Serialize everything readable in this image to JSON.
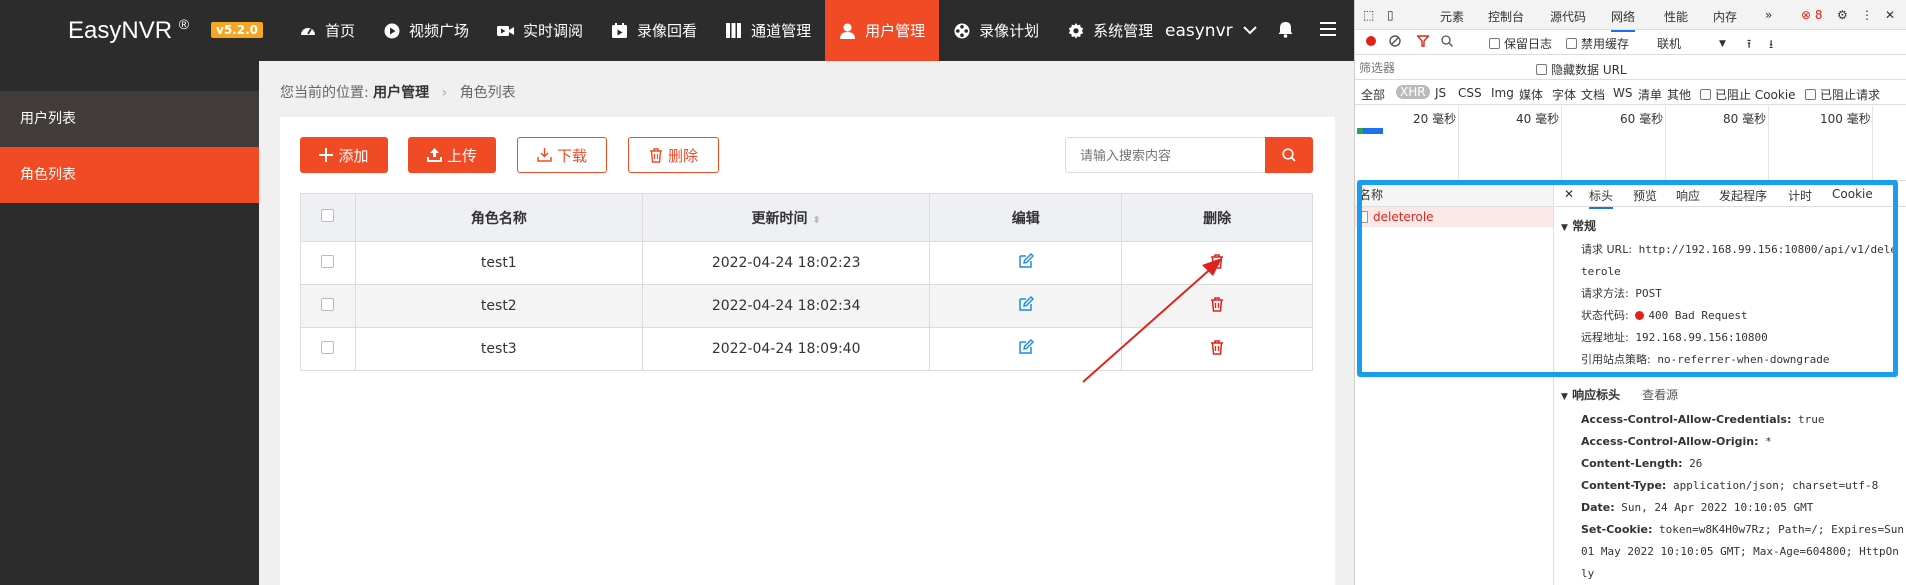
{
  "header": {
    "logo": "EasyNVR",
    "logo_mark": "®",
    "version": "v5.2.0",
    "nav": [
      {
        "label": "首页",
        "icon": "dashboard-icon"
      },
      {
        "label": "视频广场",
        "icon": "play-circle-icon"
      },
      {
        "label": "实时调阅",
        "icon": "video-camera-icon"
      },
      {
        "label": "录像回看",
        "icon": "calendar-video-icon"
      },
      {
        "label": "通道管理",
        "icon": "columns-icon"
      },
      {
        "label": "用户管理",
        "icon": "user-icon",
        "active": true
      },
      {
        "label": "录像计划",
        "icon": "film-reel-icon"
      },
      {
        "label": "系统管理",
        "icon": "gear-icon"
      }
    ],
    "username": "easynvr",
    "accent_color": "#f14b25"
  },
  "sidebar": {
    "items": [
      {
        "label": "用户列表"
      },
      {
        "label": "角色列表",
        "active": true
      }
    ]
  },
  "breadcrumb": {
    "prefix": "您当前的位置:",
    "parent": "用户管理",
    "current": "角色列表"
  },
  "toolbar": {
    "add_label": "添加",
    "upload_label": "上传",
    "download_label": "下载",
    "delete_label": "删除",
    "search_placeholder": "请输入搜索内容"
  },
  "table": {
    "headers": [
      "角色名称",
      "更新时间",
      "编辑",
      "删除"
    ],
    "rows": [
      {
        "name": "test1",
        "updated": "2022-04-24 18:02:23"
      },
      {
        "name": "test2",
        "updated": "2022-04-24 18:02:34"
      },
      {
        "name": "test3",
        "updated": "2022-04-24 18:09:40"
      }
    ]
  },
  "devtools": {
    "tabs": [
      "元素",
      "控制台",
      "源代码",
      "网络",
      "性能",
      "内存",
      "»"
    ],
    "active_tab": "网络",
    "error_count": "8",
    "toolbar": {
      "preserve_log": "保留日志",
      "disable_cache": "禁用缓存",
      "throttle": "联机"
    },
    "filter_placeholder": "筛选器",
    "hide_data_urls": "隐藏数据 URL",
    "types": [
      "全部",
      "XHR",
      "JS",
      "CSS",
      "Img",
      "媒体",
      "字体",
      "文档",
      "WS",
      "清单",
      "其他"
    ],
    "active_type": "XHR",
    "blocked_cookies": "已阻止 Cookie",
    "blocked_requests": "已阻止请求",
    "timeline_ticks": [
      "20 毫秒",
      "40 毫秒",
      "60 毫秒",
      "80 毫秒",
      "100 毫秒"
    ],
    "name_header": "名称",
    "request_name": "deleterole",
    "detail_tabs": [
      "标头",
      "预览",
      "响应",
      "发起程序",
      "计时",
      "Cookie"
    ],
    "general": {
      "title": "常规",
      "url_label": "请求 URL:",
      "url_line1": "http://192.168.99.156:10800/api/v1/dele",
      "url_line2": "terole",
      "method_label": "请求方法:",
      "method": "POST",
      "status_label": "状态代码:",
      "status": "400 Bad Request",
      "remote_label": "远程地址:",
      "remote": "192.168.99.156:10800",
      "policy_label": "引用站点策略:",
      "policy": "no-referrer-when-downgrade"
    },
    "response_headers": {
      "title": "响应标头",
      "view_source": "查看源",
      "items": [
        {
          "k": "Access-Control-Allow-Credentials:",
          "v": "true"
        },
        {
          "k": "Access-Control-Allow-Origin:",
          "v": "*"
        },
        {
          "k": "Content-Length:",
          "v": "26"
        },
        {
          "k": "Content-Type:",
          "v": "application/json; charset=utf-8"
        },
        {
          "k": "Date:",
          "v": "Sun, 24 Apr 2022 10:10:05 GMT"
        },
        {
          "k": "Set-Cookie:",
          "v": "token=w8K4H0w7Rz; Path=/; Expires=Sun,"
        }
      ],
      "cookie_line2": "01 May 2022 10:10:05 GMT; Max-Age=604800; HttpOn",
      "cookie_line3": "ly"
    }
  }
}
